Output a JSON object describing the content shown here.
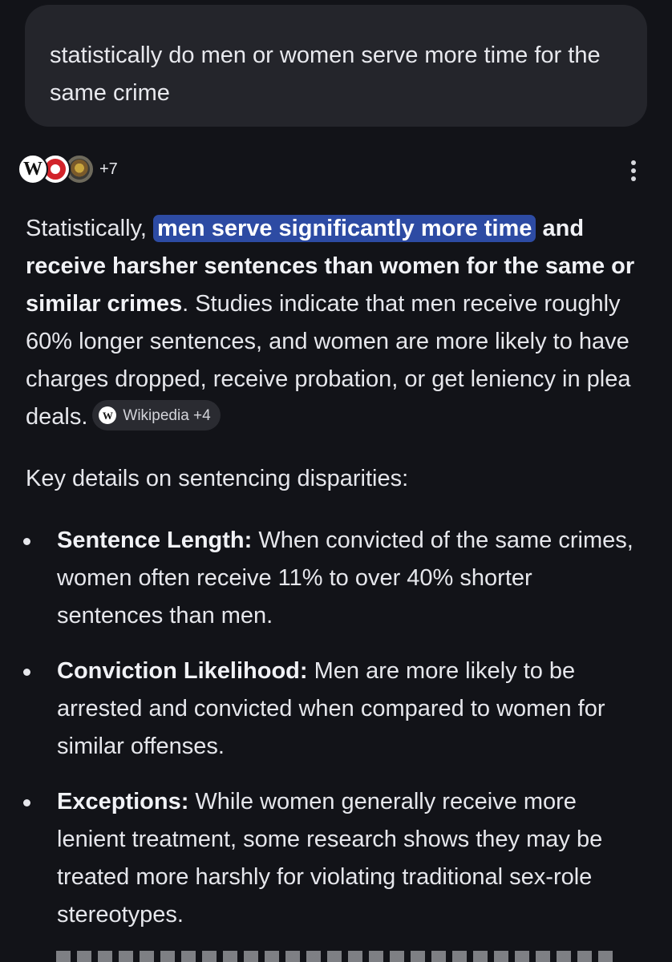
{
  "query": {
    "text": "statistically do men or women serve more time for the same crime"
  },
  "sources": {
    "count_label": "+7",
    "icons": [
      "wikipedia-icon",
      "red-ring-icon",
      "seal-icon"
    ]
  },
  "answer": {
    "intro_pre": "Statistically, ",
    "highlight": "men serve significantly more time",
    "bold_rest": " and receive harsher sentences than women for the same or similar crimes",
    "body": ". Studies indicate that men receive roughly 60% longer sentences, and women are more likely to have charges dropped, receive probation, or get leniency in plea deals.",
    "citation": {
      "icon_letter": "W",
      "label": "Wikipedia +4"
    }
  },
  "details_heading": "Key details on sentencing disparities:",
  "bullets": [
    {
      "title": "Sentence Length:",
      "text": " When convicted of the same crimes, women often receive 11% to over 40% shorter sentences than men."
    },
    {
      "title": "Conviction Likelihood:",
      "text": " Men are more likely to be arrested and convicted when compared to women for similar offenses."
    },
    {
      "title": "Exceptions:",
      "text": " While women generally receive more lenient treatment, some research shows they may be treated more harshly for violating traditional sex-role stereotypes."
    }
  ],
  "colors": {
    "background": "#121318",
    "query_bubble": "#24252b",
    "highlight": "#2d4ba3",
    "chip": "#2a2b31",
    "text": "#e6e7ec"
  }
}
